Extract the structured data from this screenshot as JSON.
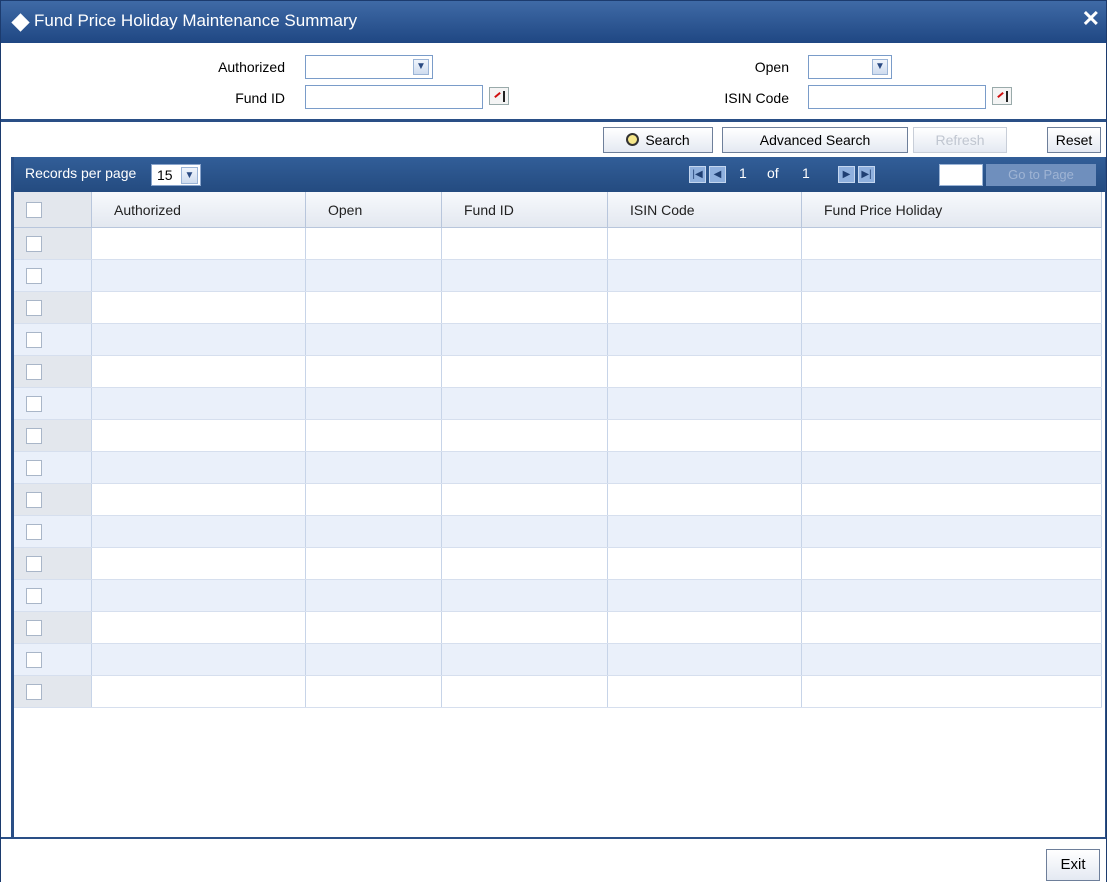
{
  "window": {
    "title": "Fund Price Holiday Maintenance Summary",
    "close_glyph": "✕"
  },
  "filters": {
    "authorized_label": "Authorized",
    "open_label": "Open",
    "fund_id_label": "Fund ID",
    "isin_code_label": "ISIN Code",
    "authorized_value": "",
    "open_value": "",
    "fund_id_value": "",
    "isin_code_value": ""
  },
  "buttons": {
    "search": "Search",
    "advanced_search": "Advanced Search",
    "refresh": "Refresh",
    "reset": "Reset",
    "exit": "Exit"
  },
  "pagination": {
    "records_per_page_label": "Records per page",
    "records_per_page": "15",
    "current_page": "1",
    "of_label": "of",
    "total_pages": "1",
    "goto_label": "Go to Page"
  },
  "table": {
    "columns": [
      "Authorized",
      "Open",
      "Fund ID",
      "ISIN Code",
      "Fund Price Holiday"
    ],
    "row_count": 15
  },
  "icons": {
    "dropdown": "chevron-down-icon",
    "lov": "list-of-values-icon",
    "search": "magnifier-icon",
    "first": "first-page-icon",
    "prev": "prev-page-icon",
    "next": "next-page-icon",
    "last": "last-page-icon"
  },
  "colors": {
    "title_bar": "#2b5591",
    "grid_toolbar": "#2c5690",
    "alt_row": "#eaf0fa"
  }
}
